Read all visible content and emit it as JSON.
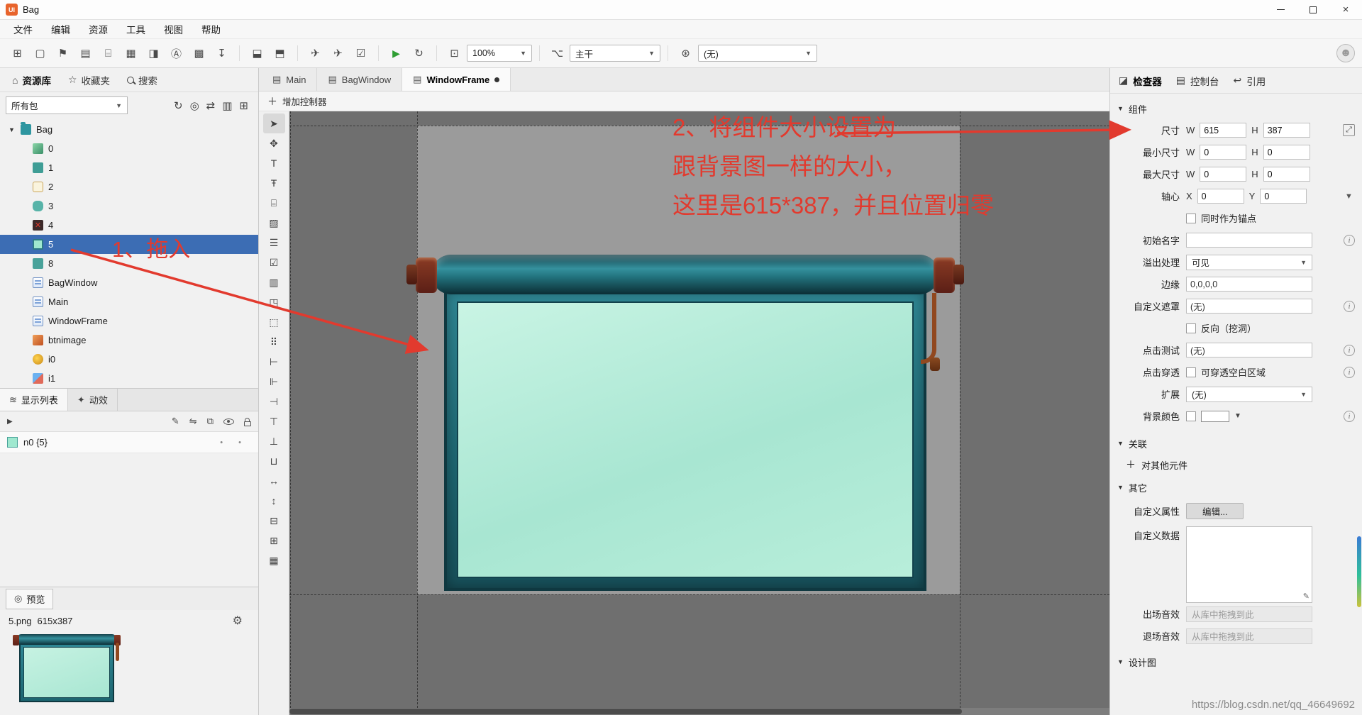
{
  "colors": {
    "selection_blue": "#3c6db4",
    "annotation_red": "#e23a2e",
    "app_badge_orange": "#e8642c",
    "paper_mint": "#b7ecdc",
    "frame_teal": "#2a7f8c",
    "canvas_dark": "#6f6f6f",
    "canvas_light": "#9b9b9b"
  },
  "titlebar": {
    "app_badge": "UI",
    "title": "Bag"
  },
  "menubar": {
    "items": [
      {
        "label": "文件"
      },
      {
        "label": "编辑"
      },
      {
        "label": "资源"
      },
      {
        "label": "工具"
      },
      {
        "label": "视图"
      },
      {
        "label": "帮助"
      }
    ]
  },
  "toolbar": {
    "zoom_value": "100%",
    "branch_value": "主干",
    "lang_value": "(无)"
  },
  "library": {
    "tabs": [
      {
        "label": "资源库"
      },
      {
        "label": "收藏夹"
      },
      {
        "label": "搜索"
      }
    ],
    "package_filter": "所有包",
    "root": {
      "label": "Bag"
    },
    "items": [
      {
        "label": "0",
        "type": "image"
      },
      {
        "label": "1",
        "type": "image-teal"
      },
      {
        "label": "2",
        "type": "button-image"
      },
      {
        "label": "3",
        "type": "image-round"
      },
      {
        "label": "4",
        "type": "image-cross"
      },
      {
        "label": "5",
        "type": "image-mint",
        "selected": true
      },
      {
        "label": "8",
        "type": "image-teal"
      },
      {
        "label": "BagWindow",
        "type": "component"
      },
      {
        "label": "Main",
        "type": "component"
      },
      {
        "label": "WindowFrame",
        "type": "component"
      },
      {
        "label": "btnimage",
        "type": "image-orange"
      },
      {
        "label": "i0",
        "type": "image-yellow"
      },
      {
        "label": "i1",
        "type": "image-color"
      }
    ]
  },
  "display_list": {
    "tabs": [
      {
        "label": "显示列表"
      },
      {
        "label": "动效"
      }
    ],
    "rows": [
      {
        "label": "n0 {5}"
      }
    ]
  },
  "preview": {
    "title": "预览",
    "file_name": "5.png",
    "file_size": "615x387"
  },
  "editor": {
    "doc_tabs": [
      {
        "label": "Main"
      },
      {
        "label": "BagWindow"
      },
      {
        "label": "WindowFrame",
        "modified": true
      }
    ],
    "add_controller": "增加控制器"
  },
  "inspector": {
    "tabs": [
      {
        "label": "检查器"
      },
      {
        "label": "控制台"
      },
      {
        "label": "引用"
      }
    ],
    "sections": {
      "component": "组件",
      "relation": "关联",
      "other": "其它",
      "design": "设计图"
    },
    "size": {
      "label": "尺寸",
      "w_label": "W",
      "w": "615",
      "h_label": "H",
      "h": "387"
    },
    "min_size": {
      "label": "最小尺寸",
      "w": "0",
      "h": "0"
    },
    "max_size": {
      "label": "最大尺寸",
      "w": "0",
      "h": "0"
    },
    "pivot": {
      "label": "轴心",
      "x_label": "X",
      "x": "0",
      "y_label": "Y",
      "y": "0",
      "anchor_label": "同时作为锚点"
    },
    "init_name": {
      "label": "初始名字",
      "value": ""
    },
    "overflow": {
      "label": "溢出处理",
      "value": "可见"
    },
    "margin": {
      "label": "边缘",
      "value": "0,0,0,0"
    },
    "mask": {
      "label": "自定义遮罩",
      "value": "(无)",
      "invert_label": "反向（挖洞）"
    },
    "hit_test": {
      "label": "点击测试",
      "value": "(无)"
    },
    "touch": {
      "label": "点击穿透",
      "option_label": "可穿透空白区域"
    },
    "extension": {
      "label": "扩展",
      "value": "(无)"
    },
    "bg_color": {
      "label": "背景颜色"
    },
    "relation_add": "对其他元件",
    "custom_props": {
      "label": "自定义属性",
      "button": "编辑..."
    },
    "custom_data": {
      "label": "自定义数据"
    },
    "enter_sound": {
      "label": "出场音效",
      "placeholder": "从库中拖拽到此"
    },
    "exit_sound": {
      "label": "退场音效",
      "placeholder": "从库中拖拽到此"
    }
  },
  "annotations": {
    "step1": "1、拖入",
    "step2_line1": "2、将组件大小设置为",
    "step2_line2": "跟背景图一样的大小，",
    "step2_line3": "这里是615*387，并且位置归零"
  },
  "watermark": "https://blog.csdn.net/qq_46649692"
}
